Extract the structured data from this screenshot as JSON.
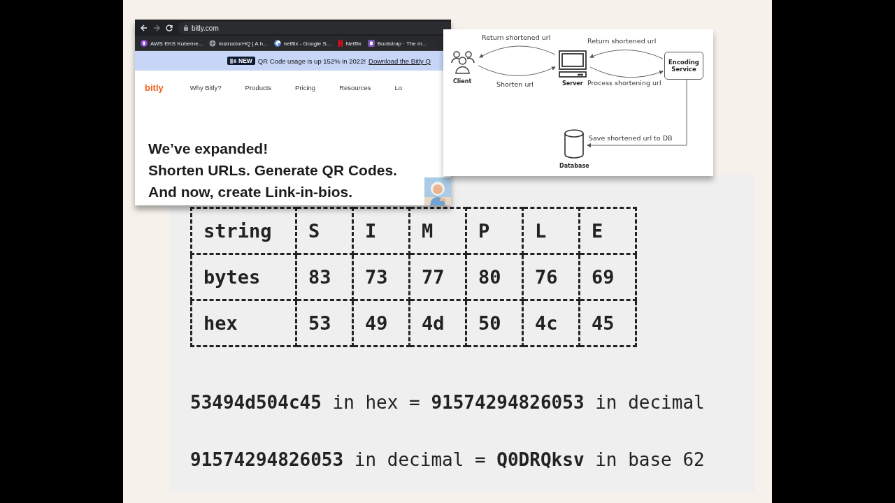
{
  "browser": {
    "url": "bitly.com",
    "bookmarks": [
      {
        "kind": "badge",
        "label": "AWS EKS Kuberne..."
      },
      {
        "kind": "globe",
        "label": "instructorHQ | A h..."
      },
      {
        "kind": "google",
        "label": "netflix - Google S..."
      },
      {
        "kind": "netflix",
        "label": "Netflix"
      },
      {
        "kind": "bootstrap",
        "label": "Bootstrap · The m..."
      }
    ],
    "banner": {
      "badge": "NEW",
      "text": "QR Code usage is up 152% in 2022!",
      "link": "Download the Bitly Q"
    },
    "nav": {
      "logo": "bitly",
      "items": [
        "Why Bitly?",
        "Products",
        "Pricing",
        "Resources",
        "Lo"
      ]
    },
    "headline": [
      "We’ve expanded!",
      "Shorten URLs. Generate QR Codes.",
      "And now, create Link-in-bios."
    ]
  },
  "diagram": {
    "nodes": [
      {
        "kind": "client",
        "label": "Client"
      },
      {
        "kind": "server",
        "label": "Server"
      },
      {
        "kind": "service",
        "label": "Encoding Service"
      },
      {
        "kind": "database",
        "label": "Database"
      }
    ],
    "edges": [
      {
        "label": "Return shortened url"
      },
      {
        "label": "Shorten url"
      },
      {
        "label": "Return shortened url"
      },
      {
        "label": "Process shortening url"
      },
      {
        "label": "Save shortened url to DB"
      }
    ]
  },
  "table": {
    "columns": [
      "string",
      "S",
      "I",
      "M",
      "P",
      "L",
      "E"
    ],
    "rows": [
      [
        "bytes",
        "83",
        "73",
        "77",
        "80",
        "76",
        "69"
      ],
      [
        "hex",
        "53",
        "49",
        "4d",
        "50",
        "4c",
        "45"
      ]
    ]
  },
  "notes": [
    "**53494d504c45** in hex = **91574294826053** in decimal",
    "**91574294826053** in decimal = **Q0DRQksv** in base 62"
  ]
}
